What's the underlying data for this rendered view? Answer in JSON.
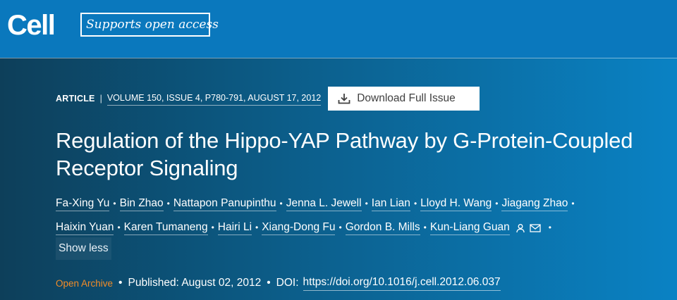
{
  "header": {
    "logo_text": "Cell",
    "open_access_badge": "Supports open access"
  },
  "meta": {
    "article_type": "ARTICLE",
    "separator": "|",
    "issue_citation": "VOLUME 150, ISSUE 4, P780-791, AUGUST 17, 2012",
    "download_label": "Download Full Issue"
  },
  "title": "Regulation of the Hippo-YAP Pathway by G-Protein-Coupled Receptor Signaling",
  "authors": {
    "line1": [
      "Fa-Xing Yu",
      "Bin Zhao",
      "Nattapon Panupinthu",
      "Jenna L. Jewell",
      "Ian Lian",
      "Lloyd H. Wang",
      "Jiagang Zhao"
    ],
    "line2": [
      "Haixin Yuan",
      "Karen Tumaneng",
      "Hairi Li",
      "Xiang-Dong Fu",
      "Gordon B. Mills",
      "Kun-Liang Guan"
    ],
    "separator": "•",
    "show_less_label": "Show less"
  },
  "footer": {
    "open_archive": "Open Archive",
    "separator": "•",
    "published": "Published: August 02, 2012",
    "doi_label": "DOI:",
    "doi_link": "https://doi.org/10.1016/j.cell.2012.06.037"
  },
  "colors": {
    "topbar": "#0a78bd",
    "open_archive": "#f28c28"
  },
  "icons": [
    "download-icon",
    "person-icon",
    "mail-icon"
  ]
}
